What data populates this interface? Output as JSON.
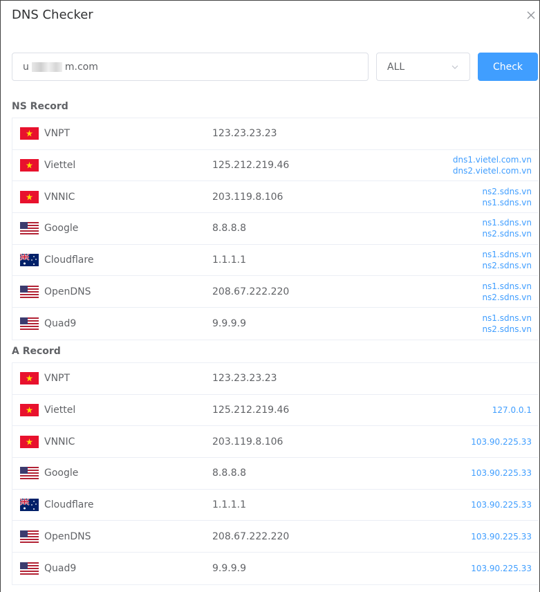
{
  "dialog": {
    "title": "DNS Checker"
  },
  "form": {
    "domain_prefix": "u",
    "domain_suffix": "m.com",
    "record_type": "ALL",
    "check_label": "Check"
  },
  "colors": {
    "accent": "#409eff",
    "link": "#409eff",
    "border": "#ebeef5"
  },
  "sections": [
    {
      "title": "NS Record",
      "rows": [
        {
          "flag": "vietnam-flag-icon",
          "provider": "VNPT",
          "ip": "123.23.23.23",
          "results": []
        },
        {
          "flag": "vietnam-flag-icon",
          "provider": "Viettel",
          "ip": "125.212.219.46",
          "results": [
            "dns1.vietel.com.vn",
            "dns2.vietel.com.vn"
          ]
        },
        {
          "flag": "vietnam-flag-icon",
          "provider": "VNNIC",
          "ip": "203.119.8.106",
          "results": [
            "ns2.sdns.vn",
            "ns1.sdns.vn"
          ]
        },
        {
          "flag": "usa-flag-icon",
          "provider": "Google",
          "ip": "8.8.8.8",
          "results": [
            "ns1.sdns.vn",
            "ns2.sdns.vn"
          ]
        },
        {
          "flag": "australia-flag-icon",
          "provider": "Cloudflare",
          "ip": "1.1.1.1",
          "results": [
            "ns1.sdns.vn",
            "ns2.sdns.vn"
          ]
        },
        {
          "flag": "usa-flag-icon",
          "provider": "OpenDNS",
          "ip": "208.67.222.220",
          "results": [
            "ns1.sdns.vn",
            "ns2.sdns.vn"
          ]
        },
        {
          "flag": "usa-flag-icon",
          "provider": "Quad9",
          "ip": "9.9.9.9",
          "results": [
            "ns1.sdns.vn",
            "ns2.sdns.vn"
          ]
        }
      ]
    },
    {
      "title": "A Record",
      "rows": [
        {
          "flag": "vietnam-flag-icon",
          "provider": "VNPT",
          "ip": "123.23.23.23",
          "results": []
        },
        {
          "flag": "vietnam-flag-icon",
          "provider": "Viettel",
          "ip": "125.212.219.46",
          "results": [
            "127.0.0.1"
          ]
        },
        {
          "flag": "vietnam-flag-icon",
          "provider": "VNNIC",
          "ip": "203.119.8.106",
          "results": [
            "103.90.225.33"
          ]
        },
        {
          "flag": "usa-flag-icon",
          "provider": "Google",
          "ip": "8.8.8.8",
          "results": [
            "103.90.225.33"
          ]
        },
        {
          "flag": "australia-flag-icon",
          "provider": "Cloudflare",
          "ip": "1.1.1.1",
          "results": [
            "103.90.225.33"
          ]
        },
        {
          "flag": "usa-flag-icon",
          "provider": "OpenDNS",
          "ip": "208.67.222.220",
          "results": [
            "103.90.225.33"
          ]
        },
        {
          "flag": "usa-flag-icon",
          "provider": "Quad9",
          "ip": "9.9.9.9",
          "results": [
            "103.90.225.33"
          ]
        }
      ]
    }
  ]
}
